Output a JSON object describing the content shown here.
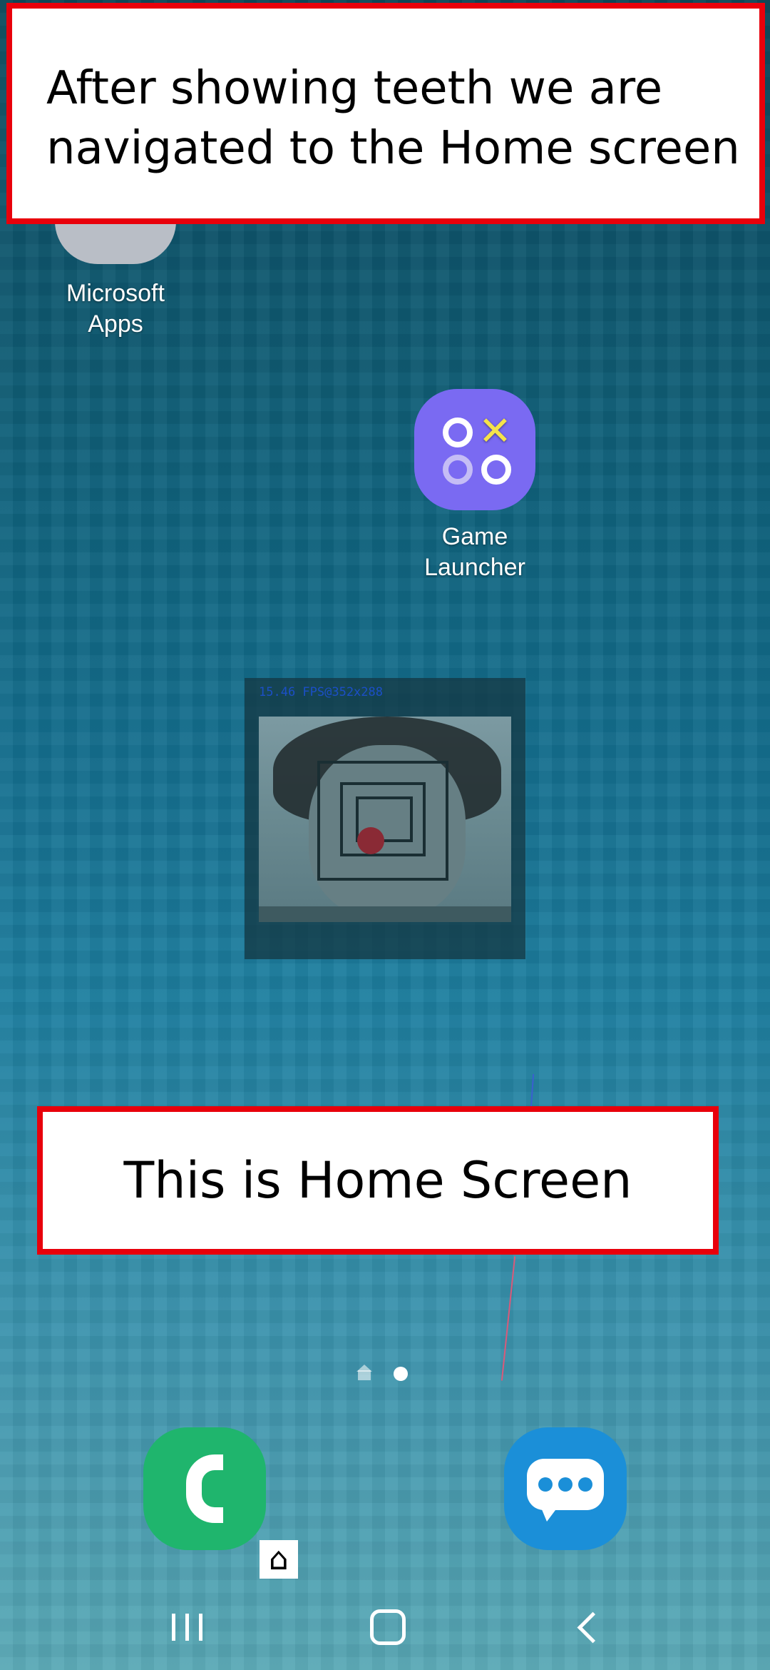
{
  "annotations": {
    "top_line1": "After showing teeth we are",
    "top_line2": "navigated to the Home screen",
    "bottom": "This is Home Screen"
  },
  "apps": {
    "microsoft": {
      "line1": "Microsoft",
      "line2": "Apps",
      "icon": "folder-icon"
    },
    "game_launcher": {
      "line1": "Game",
      "line2": "Launcher",
      "icon": "game-launcher-icon"
    }
  },
  "camera_overlay": {
    "fps_text": "15.46 FPS@352x288"
  },
  "dock": {
    "phone_icon": "phone-icon",
    "messages_icon": "messages-icon"
  },
  "page_indicator": {
    "pages": [
      "home",
      "page-1"
    ],
    "active": "page-1"
  },
  "nav_bar": {
    "recents": "recents-icon",
    "home": "home-icon",
    "back": "back-icon"
  },
  "colors": {
    "annotation_border": "#e8000b",
    "phone": "#1fb56d",
    "messages": "#1b8fd8",
    "game_launcher": "#7a6af2"
  }
}
